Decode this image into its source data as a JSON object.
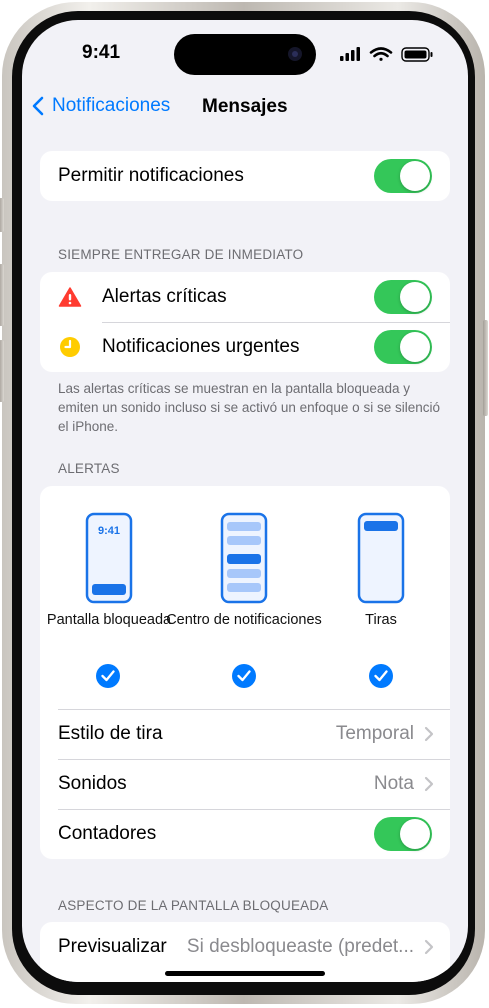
{
  "status": {
    "time": "9:41"
  },
  "nav": {
    "back_label": "Notificaciones",
    "title": "Mensajes"
  },
  "allow": {
    "label": "Permitir notificaciones",
    "on": true
  },
  "immediate": {
    "header": "SIEMPRE ENTREGAR DE INMEDIATO",
    "critical_label": "Alertas críticas",
    "urgent_label": "Notificaciones urgentes",
    "footnote": "Las alertas críticas se muestran en la pantalla bloqueada y emiten un sonido incluso si se activó un enfoque o si se silenció el iPhone."
  },
  "alerts": {
    "header": "ALERTAS",
    "styles": [
      {
        "label": "Pantalla bloqueada",
        "phone_time": "9:41",
        "checked": true
      },
      {
        "label": "Centro de notificaciones",
        "checked": true
      },
      {
        "label": "Tiras",
        "checked": true
      }
    ],
    "banner_style": {
      "label": "Estilo de tira",
      "value": "Temporal"
    },
    "sounds": {
      "label": "Sonidos",
      "value": "Nota"
    },
    "badges": {
      "label": "Contadores",
      "on": true
    }
  },
  "lock_screen": {
    "header": "ASPECTO DE LA PANTALLA BLOQUEADA",
    "preview": {
      "label": "Previsualizar",
      "value": "Si desbloqueaste (predet..."
    }
  },
  "colors": {
    "accent": "#007aff",
    "toggle_on": "#34c759",
    "critical": "#ff3b30",
    "urgent": "#ffcc00",
    "background": "#f2f2f7"
  }
}
